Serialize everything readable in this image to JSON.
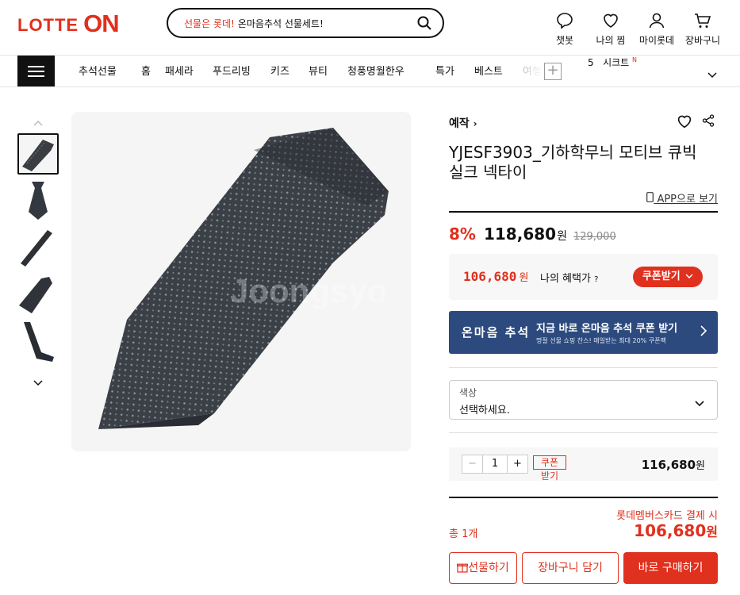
{
  "header": {
    "logo_left": "LOTTE",
    "logo_right": "ON",
    "search_prefix": "선물은 롯데!",
    "search_text": "온마음추석 선물세트!",
    "icons": [
      {
        "icon": "chat-icon",
        "label": "챗봇"
      },
      {
        "icon": "heart-icon",
        "label": "나의 찜"
      },
      {
        "icon": "user-icon",
        "label": "마이롯데"
      },
      {
        "icon": "cart-icon",
        "label": "장바구니"
      }
    ]
  },
  "nav": {
    "items": [
      "추석선물",
      "홈",
      "패세라",
      "푸드리빙",
      "키즈",
      "뷰티",
      "청풍명월한우",
      "특가",
      "베스트",
      "여행"
    ],
    "plus": "+",
    "rank_number": "5",
    "rank_text": "시크트",
    "rank_badge": "N"
  },
  "product": {
    "brand": "예작",
    "title": "YJESF3903_기하학무늬 모티브 큐빅 실크 넥타이",
    "app_link": "APP으로 보기",
    "discount": "8%",
    "price": "118,680",
    "won": "원",
    "original_price": "129,000",
    "benefit_price": "106,680",
    "benefit_won": "원",
    "benefit_label": "나의 혜택가",
    "coupon_button": "쿠폰받기",
    "watermark": "Joongsyo"
  },
  "banner": {
    "left": "온마음 추석",
    "title": "지금 바로 온마음 추석 쿠폰 받기",
    "subtitle": "명절 선물 쇼핑 찬스! 매일받는 최대 20% 쿠폰팩"
  },
  "option": {
    "label": "색상",
    "value": "선택하세요."
  },
  "quantity": {
    "minus": "−",
    "value": "1",
    "plus": "+",
    "coupon_line1": "쿠폰",
    "coupon_line2": "받기",
    "price": "116,680",
    "won": "원"
  },
  "total": {
    "label": "총 1개",
    "card_label": "롯데멤버스카드 결제 시",
    "price": "106,680",
    "won": "원"
  },
  "buttons": {
    "gift": "선물하기",
    "cart": "장바구니 담기",
    "buy": "바로 구매하기"
  },
  "colors": {
    "brand_red": "#e0301e",
    "banner_blue": "#2c4a7e"
  }
}
